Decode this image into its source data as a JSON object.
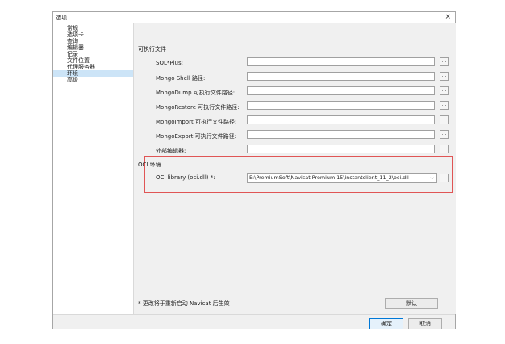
{
  "window": {
    "title": "选项",
    "close_icon": "×"
  },
  "sidebar": {
    "items": [
      {
        "label": "常规"
      },
      {
        "label": "选项卡"
      },
      {
        "label": "查询"
      },
      {
        "label": "编辑器"
      },
      {
        "label": "记录"
      },
      {
        "label": "文件位置"
      },
      {
        "label": "代理服务器"
      },
      {
        "label": "环境",
        "selected": true
      },
      {
        "label": "高级"
      }
    ]
  },
  "executables": {
    "section_label": "可执行文件",
    "rows": [
      {
        "label": "SQL*Plus:",
        "value": ""
      },
      {
        "label": "Mongo Shell 路径:",
        "value": ""
      },
      {
        "label": "MongoDump 可执行文件路径:",
        "value": ""
      },
      {
        "label": "MongoRestore 可执行文件路径:",
        "value": ""
      },
      {
        "label": "MongoImport 可执行文件路径:",
        "value": ""
      },
      {
        "label": "MongoExport 可执行文件路径:",
        "value": ""
      },
      {
        "label": "外部编辑器:",
        "value": ""
      }
    ],
    "browse_label": "..."
  },
  "oci": {
    "section_label": "OCI 环境",
    "library_label": "OCI library (oci.dll) *:",
    "library_value": "E:\\PremiumSoft\\Navicat Premium 15\\instantclient_11_2\\oci.dll",
    "browse_label": "...",
    "highlight_color": "#e05555"
  },
  "note": "* 更改将于重新启动 Navicat 后生效",
  "buttons": {
    "default": "默认",
    "ok": "确定",
    "cancel": "取消"
  }
}
